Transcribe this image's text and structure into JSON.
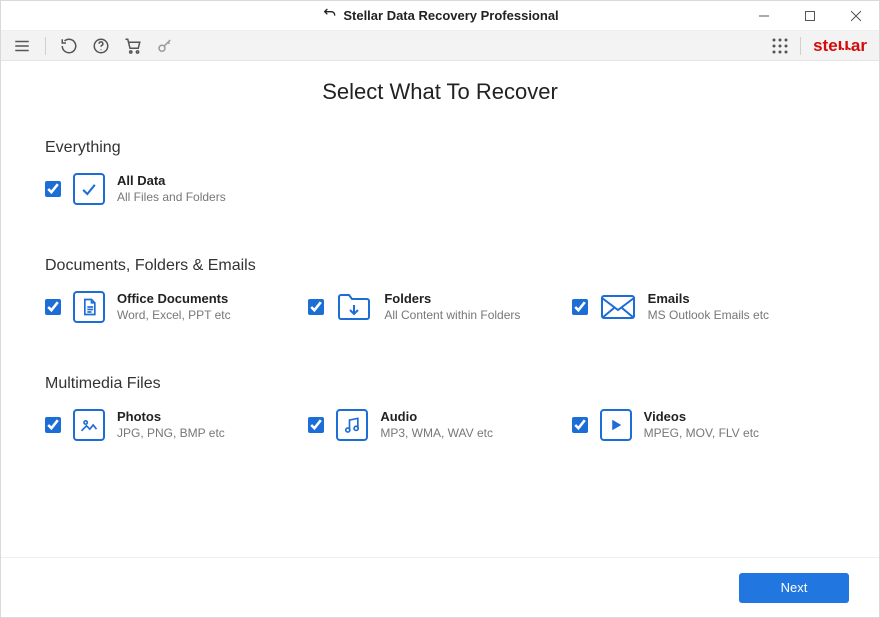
{
  "window": {
    "title": "Stellar Data Recovery Professional"
  },
  "brand": "stellar",
  "page_title": "Select What To Recover",
  "sections": {
    "everything": {
      "heading": "Everything",
      "all_data": {
        "title": "All Data",
        "sub": "All Files and Folders"
      }
    },
    "docs": {
      "heading": "Documents, Folders & Emails",
      "office": {
        "title": "Office Documents",
        "sub": "Word, Excel, PPT etc"
      },
      "folders": {
        "title": "Folders",
        "sub": "All Content within Folders"
      },
      "emails": {
        "title": "Emails",
        "sub": "MS Outlook Emails etc"
      }
    },
    "media": {
      "heading": "Multimedia Files",
      "photos": {
        "title": "Photos",
        "sub": "JPG, PNG, BMP etc"
      },
      "audio": {
        "title": "Audio",
        "sub": "MP3, WMA, WAV etc"
      },
      "videos": {
        "title": "Videos",
        "sub": "MPEG, MOV, FLV etc"
      }
    }
  },
  "footer": {
    "next": "Next"
  }
}
